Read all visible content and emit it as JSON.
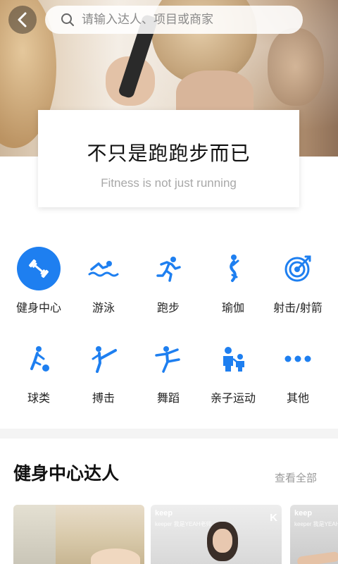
{
  "search": {
    "placeholder": "请输入达人、项目或商家"
  },
  "banner": {
    "title_cn": "不只是跑跑步而已",
    "title_en": "Fitness is not just running"
  },
  "categories": [
    {
      "label": "健身中心",
      "icon": "dumbbell-icon",
      "active": true
    },
    {
      "label": "游泳",
      "icon": "swimmer-icon"
    },
    {
      "label": "跑步",
      "icon": "runner-icon"
    },
    {
      "label": "瑜伽",
      "icon": "yoga-icon"
    },
    {
      "label": "射击/射箭",
      "icon": "target-icon"
    },
    {
      "label": "球类",
      "icon": "ball-player-icon"
    },
    {
      "label": "搏击",
      "icon": "martial-arts-icon"
    },
    {
      "label": "舞蹈",
      "icon": "dancer-icon"
    },
    {
      "label": "亲子运动",
      "icon": "family-icon"
    },
    {
      "label": "其他",
      "icon": "more-dots-icon"
    }
  ],
  "experts": {
    "title": "健身中心达人",
    "view_all": "查看全部",
    "cards": [
      {
        "brand": "",
        "subtitle": ""
      },
      {
        "brand": "keep",
        "subtitle": "keeper 我是YEAH老师"
      },
      {
        "brand": "keep",
        "subtitle": "keeper 我是YEAH老师"
      }
    ]
  },
  "colors": {
    "accent": "#1e7ff0"
  }
}
